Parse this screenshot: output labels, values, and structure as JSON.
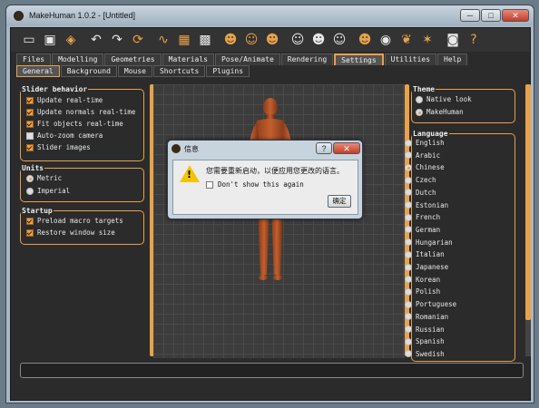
{
  "window": {
    "title": "MakeHuman 1.0.2 - [Untitled]",
    "min_label": "─",
    "max_label": "□",
    "close_label": "✕"
  },
  "menu_tabs": [
    {
      "label": "Files"
    },
    {
      "label": "Modelling"
    },
    {
      "label": "Geometries"
    },
    {
      "label": "Materials"
    },
    {
      "label": "Pose/Animate"
    },
    {
      "label": "Rendering"
    },
    {
      "label": "Settings"
    },
    {
      "label": "Utilities"
    },
    {
      "label": "Help"
    }
  ],
  "sub_tabs": [
    {
      "label": "General"
    },
    {
      "label": "Background"
    },
    {
      "label": "Mouse"
    },
    {
      "label": "Shortcuts"
    },
    {
      "label": "Plugins"
    }
  ],
  "slider_behavior": {
    "title": "Slider behavior",
    "items": [
      {
        "label": "Update real-time",
        "checked": true
      },
      {
        "label": "Update normals real-time",
        "checked": true
      },
      {
        "label": "Fit objects real-time",
        "checked": true
      },
      {
        "label": "Auto-zoom camera",
        "checked": false
      },
      {
        "label": "Slider images",
        "checked": true
      }
    ]
  },
  "units": {
    "title": "Units",
    "items": [
      {
        "label": "Metric",
        "selected": true
      },
      {
        "label": "Imperial",
        "selected": false
      }
    ]
  },
  "startup": {
    "title": "Startup",
    "items": [
      {
        "label": "Preload macro targets",
        "checked": true
      },
      {
        "label": "Restore window size",
        "checked": true
      }
    ]
  },
  "theme": {
    "title": "Theme",
    "items": [
      {
        "label": "Native look",
        "selected": false
      },
      {
        "label": "MakeHuman",
        "selected": true
      }
    ]
  },
  "language": {
    "title": "Language",
    "items": [
      {
        "label": "English",
        "selected": false
      },
      {
        "label": "Arabic",
        "selected": false
      },
      {
        "label": "Chinese",
        "selected": true
      },
      {
        "label": "Czech",
        "selected": false
      },
      {
        "label": "Dutch",
        "selected": false
      },
      {
        "label": "Estonian",
        "selected": false
      },
      {
        "label": "French",
        "selected": false
      },
      {
        "label": "German",
        "selected": false
      },
      {
        "label": "Hungarian",
        "selected": false
      },
      {
        "label": "Italian",
        "selected": false
      },
      {
        "label": "Japanese",
        "selected": false
      },
      {
        "label": "Korean",
        "selected": false
      },
      {
        "label": "Polish",
        "selected": false
      },
      {
        "label": "Portuguese",
        "selected": false
      },
      {
        "label": "Romanian",
        "selected": false
      },
      {
        "label": "Russian",
        "selected": false
      },
      {
        "label": "Spanish",
        "selected": false
      },
      {
        "label": "Swedish",
        "selected": false
      }
    ]
  },
  "dialog": {
    "title": "信息",
    "message": "您需要重新启动，以便应用您更改的语言。",
    "checkbox_label": "Don't show this again",
    "ok_label": "确定",
    "help_label": "?",
    "close_label": "✕"
  },
  "colors": {
    "accent": "#e8a24a",
    "panel": "#2b2b2b"
  }
}
